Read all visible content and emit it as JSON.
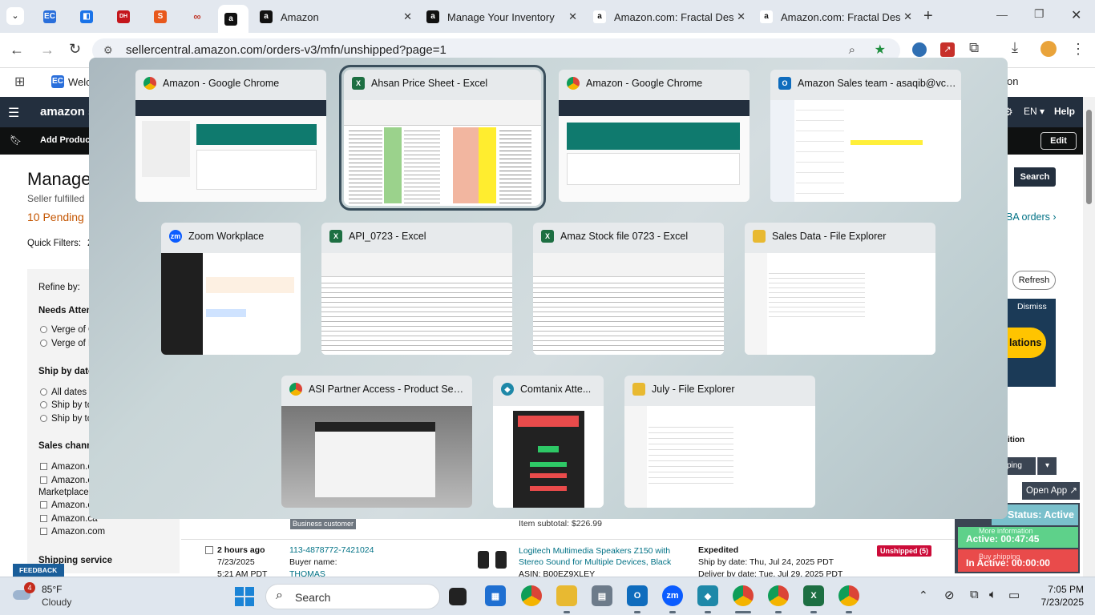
{
  "browser": {
    "tabs": [
      {
        "title": "",
        "icon": "ec-icon"
      },
      {
        "title": "",
        "icon": "app-icon"
      },
      {
        "title": "",
        "icon": "dh-icon"
      },
      {
        "title": "",
        "icon": "s-icon"
      },
      {
        "title": "",
        "icon": "link-icon"
      },
      {
        "title": "",
        "icon": "amazon-icon"
      },
      {
        "title": "Amazon",
        "icon": "amazon-icon"
      },
      {
        "title": "Manage Your Inventory",
        "icon": "amazon-icon"
      },
      {
        "title": "Amazon.com: Fractal Desi",
        "icon": "amazon-icon"
      },
      {
        "title": "Amazon.com: Fractal Desi",
        "icon": "amazon-icon"
      }
    ],
    "url": "sellercentral.amazon.com/orders-v3/mfn/unshipped?page=1",
    "bookmark_partial": "Welc",
    "bookmark_right": "on"
  },
  "seller": {
    "logo": "amazon se",
    "add_products": "Add Products",
    "lang": "EN",
    "help": "Help",
    "edit": "Edit",
    "page_title": "Manage",
    "seller_fulfilled": "Seller fulfilled",
    "pending": "10 Pending",
    "quick_filters": "Quick Filters:",
    "qf_value": "2",
    "search": "Search",
    "ba_orders": "BA orders",
    "refresh": "Refresh",
    "dismiss": "Dismiss",
    "lations": "lations",
    "ition": "ition",
    "ping": "ping",
    "refine_by": "Refine by:",
    "needs_attention": "Needs Attent",
    "needs_items": [
      "Verge of C",
      "Verge of L"
    ],
    "ship_by_date": "Ship by date",
    "ship_items": [
      "All dates",
      "Ship by to",
      "Ship by to"
    ],
    "sales_channel": "Sales channe",
    "sales_items": [
      "Amazon.co",
      "Amazon.co",
      "Amazon.co",
      "Amazon.ca",
      "Amazon.com"
    ],
    "marketplace": "Marketplace",
    "shipping_service": "Shipping service",
    "feedback": "FEEDBACK",
    "business_customer": "Business customer",
    "item_subtotal": "Item subtotal: $226.99",
    "order": {
      "age": "2 hours ago",
      "date": "7/23/2025",
      "time": "5:21 AM PDT",
      "order_id": "113-4878772-7421024",
      "buyer_label": "Buyer name:",
      "buyer": "THOMAS",
      "product": "Logitech Multimedia Speakers Z150 with Stereo Sound for Multiple Devices, Black",
      "asin": "ASIN: B00EZ9XLEY",
      "shipping": "Expedited",
      "ship_by": "Ship by date: Thu, Jul 24, 2025 PDT",
      "deliver_by": "Deliver by date: Tue, Jul 29, 2025 PDT",
      "status": "Unshipped (5)"
    }
  },
  "side_panel": {
    "open_app": "Open App",
    "status": "Status: Active",
    "more_info": "More information",
    "active": "Active: 00:47:45",
    "buy_shipping": "Buy shipping",
    "inactive": "In Active: 00:00:00"
  },
  "switcher": {
    "windows": [
      {
        "title": "Amazon - Google Chrome",
        "icon": "chrome-icon"
      },
      {
        "title": "Ahsan Price Sheet - Excel",
        "icon": "excel-icon"
      },
      {
        "title": "Amazon - Google Chrome",
        "icon": "chrome-icon"
      },
      {
        "title": "Amazon Sales team - asaqib@vcl...",
        "icon": "outlook-icon"
      },
      {
        "title": "Zoom Workplace",
        "icon": "zoom-icon"
      },
      {
        "title": "API_0723 - Excel",
        "icon": "excel-icon"
      },
      {
        "title": "Amaz Stock file 0723 - Excel",
        "icon": "excel-icon"
      },
      {
        "title": "Sales Data - File Explorer",
        "icon": "folder-icon"
      },
      {
        "title": "ASI Partner Access - Product Sear...",
        "icon": "chrome-icon"
      },
      {
        "title": "Comtanix Atte...",
        "icon": "comtanix-icon"
      },
      {
        "title": "July - File Explorer",
        "icon": "folder-icon"
      }
    ]
  },
  "taskbar": {
    "weather_temp": "85°F",
    "weather_desc": "Cloudy",
    "weather_badge": "4",
    "search_label": "Search",
    "time": "7:05 PM",
    "date": "7/23/2025"
  },
  "colors": {
    "amazon_dark": "#232f3e",
    "excel_green": "#1d6f42",
    "chrome_tab_bg": "#e3e8ef",
    "status_red": "#cc0c39",
    "side_green": "#5ed18a"
  }
}
